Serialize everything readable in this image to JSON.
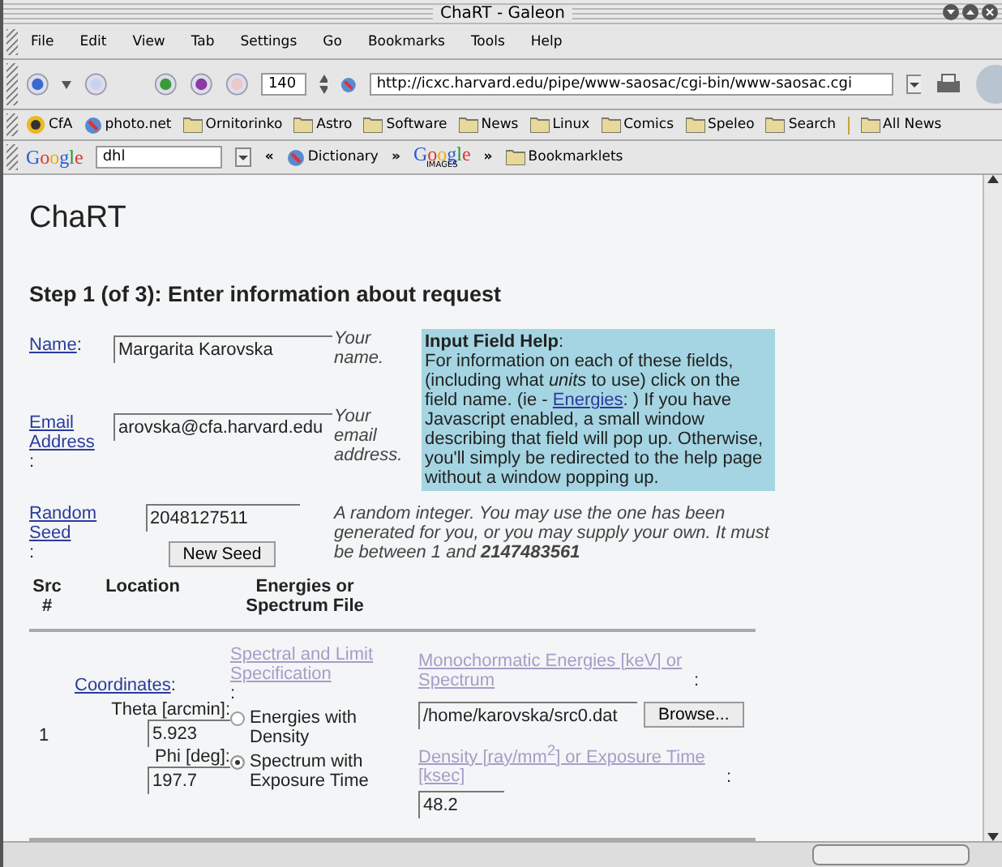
{
  "window": {
    "title": "ChaRT - Galeon"
  },
  "menu": [
    "File",
    "Edit",
    "View",
    "Tab",
    "Settings",
    "Go",
    "Bookmarks",
    "Tools",
    "Help"
  ],
  "nav": {
    "zoom": "140",
    "url": "http://icxc.harvard.edu/pipe/www-saosac/cgi-bin/www-saosac.cgi"
  },
  "bookmarks": [
    {
      "kind": "logo",
      "label": "CfA"
    },
    {
      "kind": "globe",
      "label": "photo.net"
    },
    {
      "kind": "folder",
      "label": "Ornitorinko"
    },
    {
      "kind": "folder",
      "label": "Astro"
    },
    {
      "kind": "folder",
      "label": "Software"
    },
    {
      "kind": "folder",
      "label": "News"
    },
    {
      "kind": "folder",
      "label": "Linux"
    },
    {
      "kind": "folder",
      "label": "Comics"
    },
    {
      "kind": "folder",
      "label": "Speleo"
    },
    {
      "kind": "folder",
      "label": "Search"
    },
    {
      "kind": "separator"
    },
    {
      "kind": "folder",
      "label": "All News"
    }
  ],
  "googlebar": {
    "logo": "Google",
    "query": "dhl",
    "back": "«",
    "dictionary": "Dictionary",
    "forward": "»",
    "images_logo": "Google",
    "images_sub": "IMAGES",
    "more": "»",
    "bookmarklets": "Bookmarklets"
  },
  "page": {
    "title": "ChaRT",
    "heading": "Step 1 (of 3): Enter information about request",
    "fields": [
      {
        "link": "Name",
        "colon": ":",
        "value": "Margarita Karovska",
        "note": "Your name."
      },
      {
        "link": "Email Address",
        "colon": ":",
        "value": "arovska@cfa.harvard.edu",
        "note": "Your email address."
      }
    ],
    "help": {
      "title": "Input Field Help",
      "title_colon": ":",
      "text": "For information on each of these fields, (including what *units* to use) click on the field name. (ie - ",
      "link": "Energies",
      "rest": ": ) If you have Javascript enabled, a small window describing that field will pop up. Otherwise, you'll simply be redirected to the help page without a window popping up."
    },
    "seed": {
      "link": "Random Seed",
      "colon": ":",
      "value": "2048127511",
      "button": "New Seed",
      "note": "A random integer. You may use the one has been generated for you, or you may supply your own. It must be between 1 and **2147483561**"
    },
    "columns": [
      "Src #",
      "Location",
      "Energies or Spectrum File"
    ],
    "source": {
      "number": "1",
      "coordinates": "Coordinates",
      "colon": ":",
      "theta_label": "Theta [arcmin]:",
      "theta": "5.923",
      "phi_label": "Phi [deg]:",
      "phi": "197.7",
      "spec_link": "Spectral and Limit Specification",
      "options": [
        {
          "label": "Energies with Density",
          "selected": false
        },
        {
          "label": "Spectrum with Exposure Time",
          "selected": true
        }
      ],
      "energy_link": "Monochormatic Energies [keV] or Spectrum",
      "file": "/home/karovska/src0.dat",
      "browse": "Browse...",
      "density_link": "Density [ray/mm$^{2}$] or Exposure Time [ksec]",
      "density": "48.2"
    }
  }
}
